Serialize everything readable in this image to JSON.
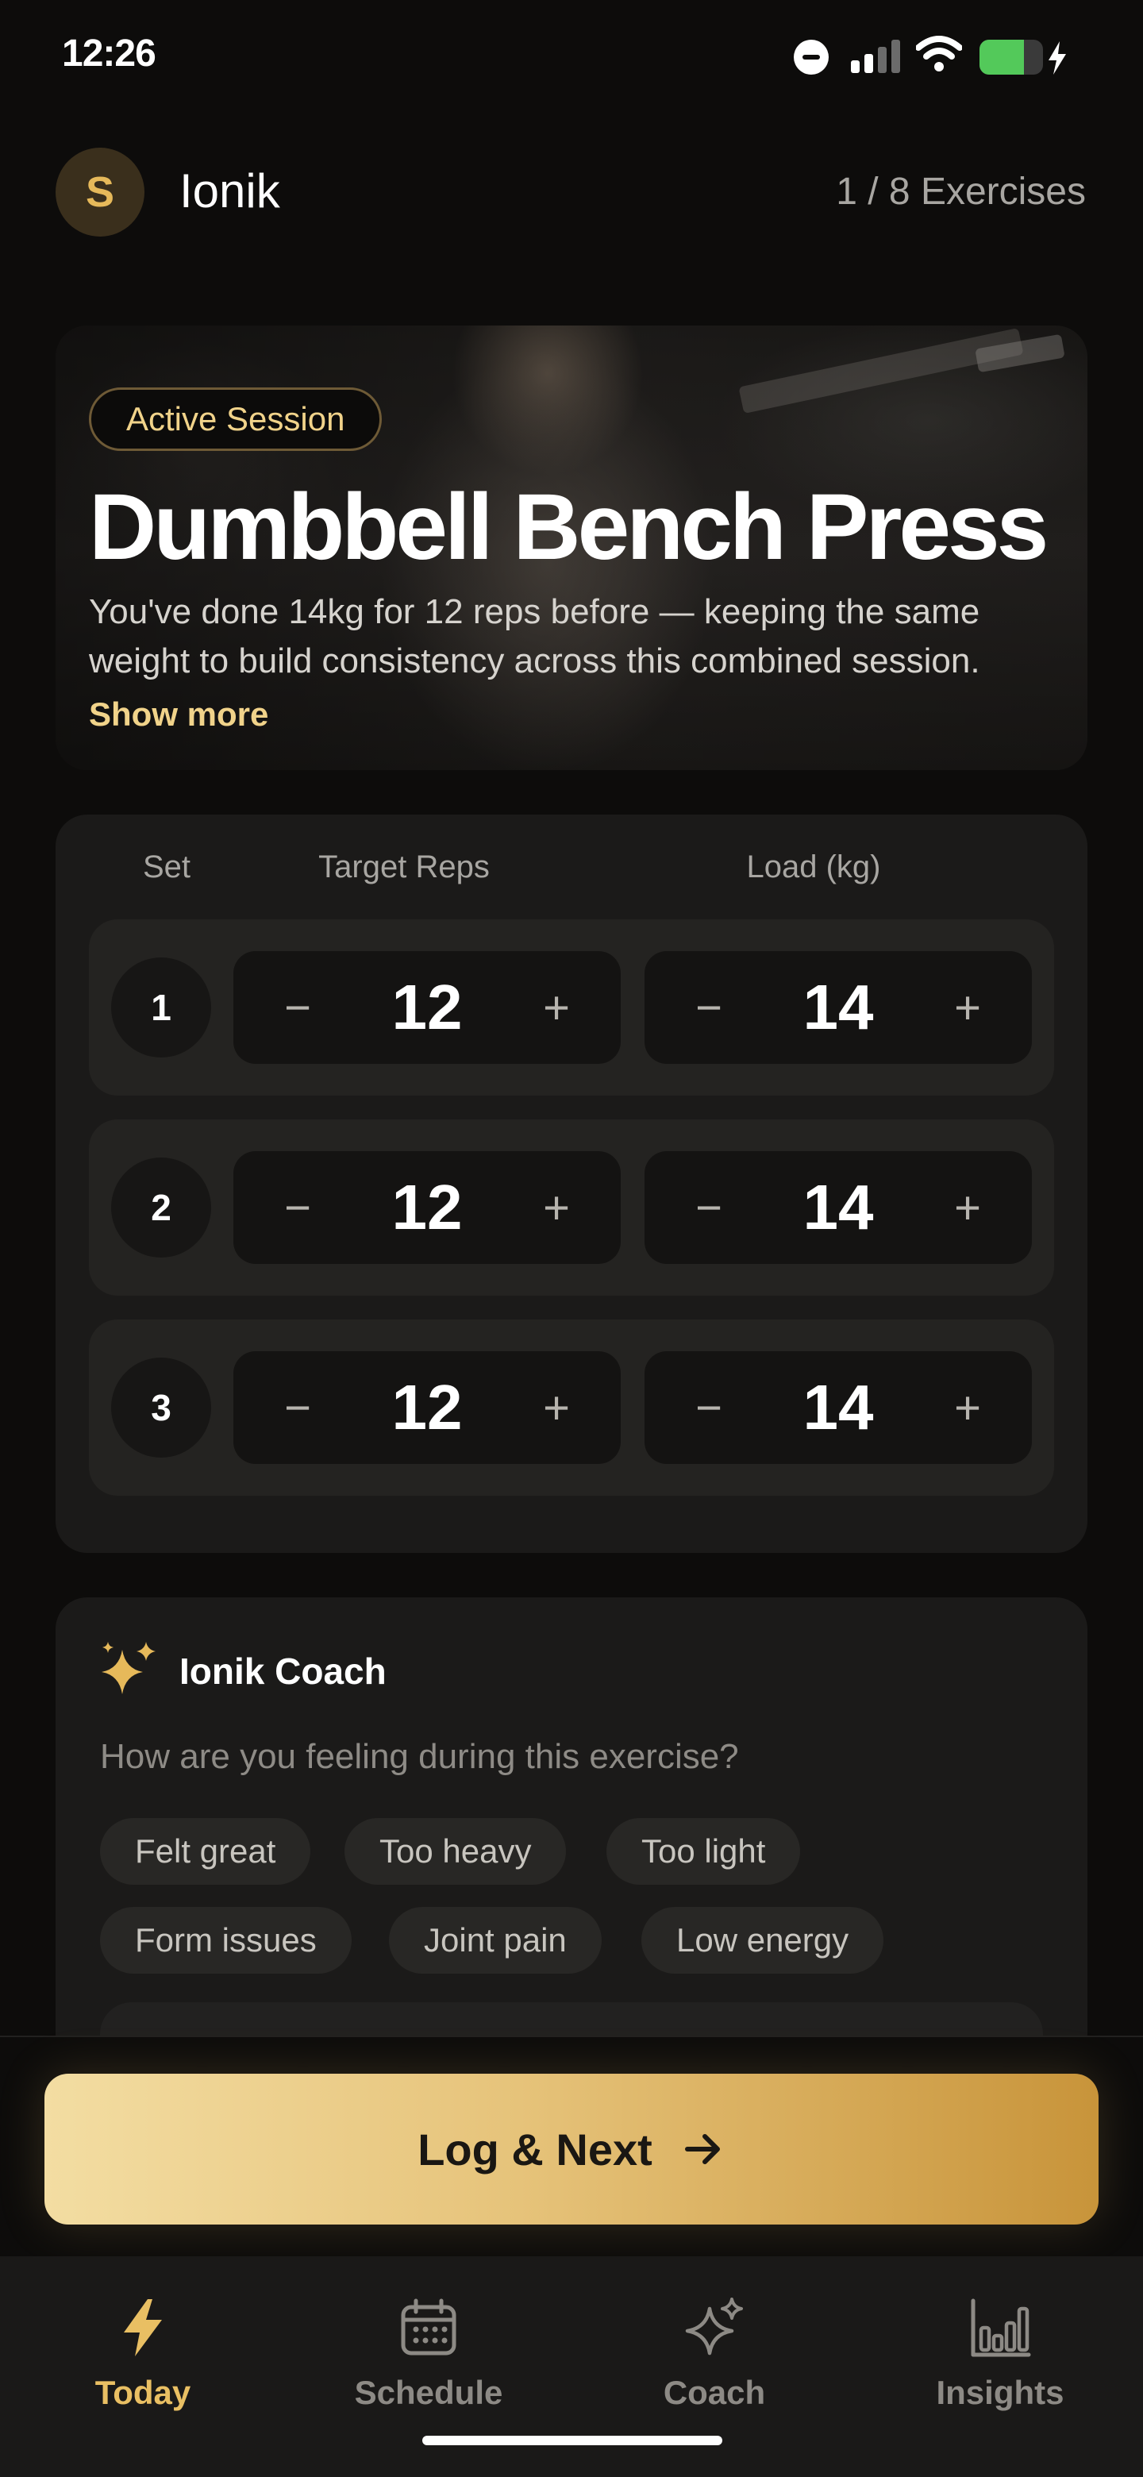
{
  "status_bar": {
    "time": "12:26",
    "battery_level": 0.7,
    "accent_green": "#53c95a"
  },
  "header": {
    "avatar_initial": "S",
    "app_name": "Ionik",
    "exercise_progress": "1 / 8 Exercises"
  },
  "hero": {
    "badge": "Active Session",
    "title": "Dumbbell Bench Press",
    "description": "You've done 14kg for 12 reps before — keeping the same weight to build consistency across this combined session.",
    "show_more": "Show more"
  },
  "sets_table": {
    "columns": [
      "Set",
      "Target Reps",
      "Load (kg)"
    ],
    "decrement_symbol": "−",
    "increment_symbol": "+",
    "rows": [
      {
        "set": "1",
        "reps": "12",
        "load": "14"
      },
      {
        "set": "2",
        "reps": "12",
        "load": "14"
      },
      {
        "set": "3",
        "reps": "12",
        "load": "14"
      }
    ]
  },
  "coach": {
    "icon": "sparkles-icon",
    "title": "Ionik Coach",
    "question": "How are you feeling during this exercise?",
    "chips": [
      "Felt great",
      "Too heavy",
      "Too light",
      "Form issues",
      "Joint pain",
      "Low energy"
    ]
  },
  "cta": {
    "label": "Log & Next",
    "icon": "arrow-right-icon"
  },
  "tabs": [
    {
      "label": "Today",
      "icon": "bolt-icon",
      "active": true
    },
    {
      "label": "Schedule",
      "icon": "calendar-icon",
      "active": false
    },
    {
      "label": "Coach",
      "icon": "sparkles-icon",
      "active": false
    },
    {
      "label": "Insights",
      "icon": "bar-chart-icon",
      "active": false
    }
  ],
  "colors": {
    "accent_gold": "#e9bf63",
    "background": "#0d0c0b",
    "card": "#1b1a19"
  }
}
